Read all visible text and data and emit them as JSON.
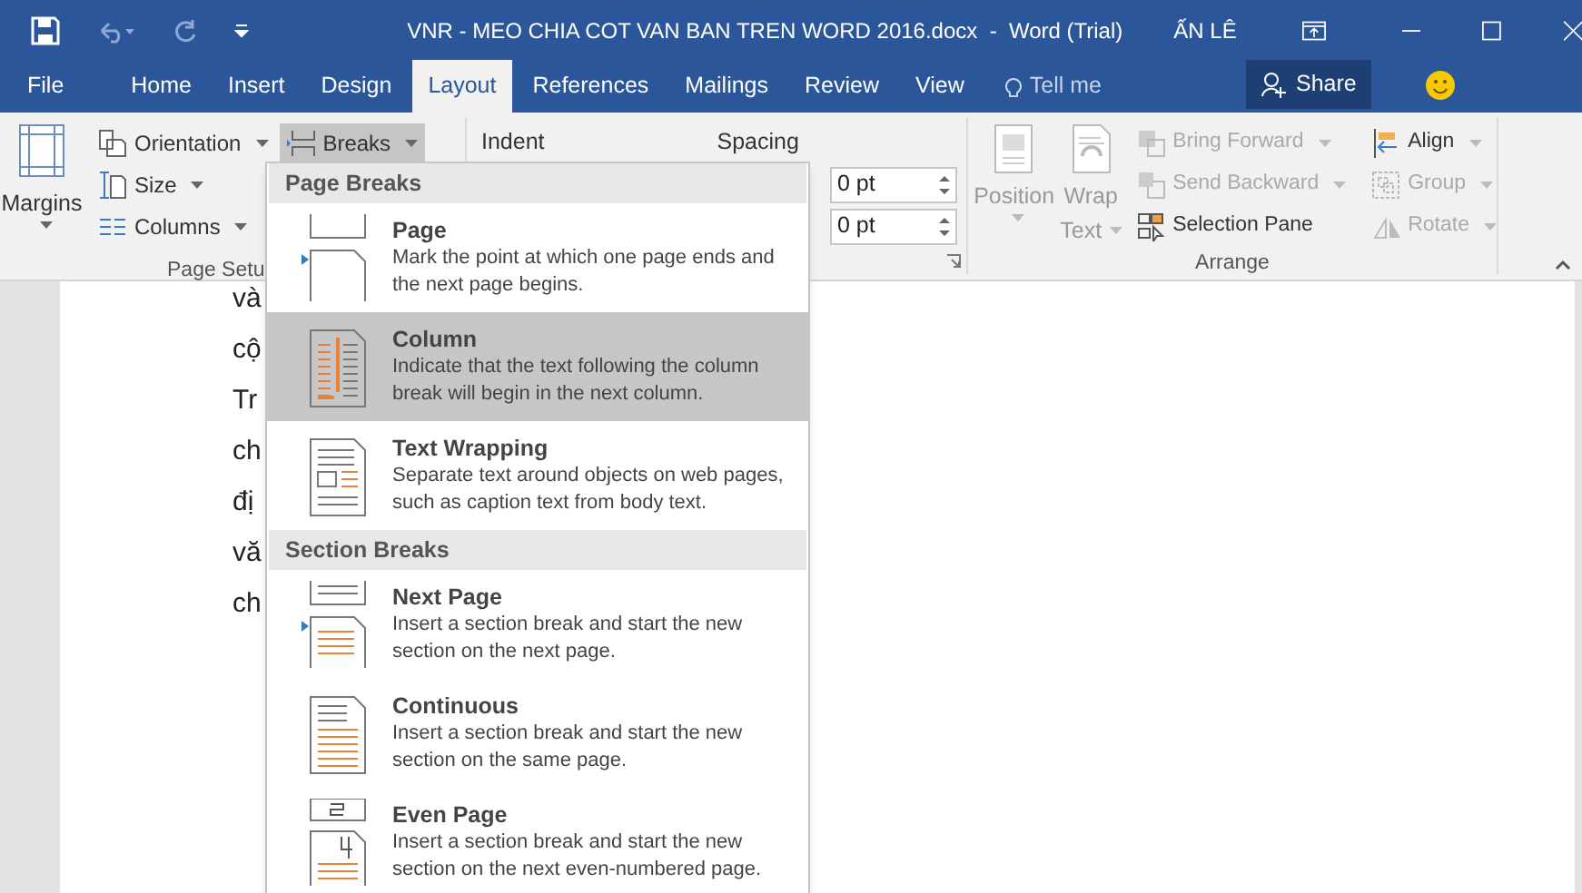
{
  "title_bar": {
    "title": "VNR - MEO CHIA COT VAN BAN TREN WORD 2016.docx  -  Word (Trial)",
    "user": "ẤN LÊ"
  },
  "tabs": [
    {
      "label": "File",
      "selected": false
    },
    {
      "label": "Home",
      "selected": false
    },
    {
      "label": "Insert",
      "selected": false
    },
    {
      "label": "Design",
      "selected": false
    },
    {
      "label": "Layout",
      "selected": true
    },
    {
      "label": "References",
      "selected": false
    },
    {
      "label": "Mailings",
      "selected": false
    },
    {
      "label": "Review",
      "selected": false
    },
    {
      "label": "View",
      "selected": false
    }
  ],
  "tell_me": {
    "placeholder": "Tell me"
  },
  "share_button": "Share",
  "page_setup": {
    "margins": "Margins",
    "orientation": "Orientation",
    "size": "Size",
    "columns": "Columns",
    "breaks": {
      "label": "Breaks",
      "expanded": true
    },
    "group_label": "Page Setu"
  },
  "paragraph": {
    "indent": "Indent",
    "spacing": "Spacing",
    "spacing_before": "0 pt",
    "spacing_after": "0 pt"
  },
  "arrange": {
    "position": "Position",
    "wrap": "Wrap",
    "text": "Text",
    "commands": [
      {
        "kind": "bring",
        "label": "Bring Forward",
        "disabled": true
      },
      {
        "kind": "send",
        "label": "Send Backward",
        "disabled": true
      },
      {
        "kind": "pane",
        "label": "Selection Pane",
        "disabled": false
      }
    ],
    "commands_right": [
      {
        "kind": "align",
        "label": "Align",
        "disabled": false
      },
      {
        "kind": "group",
        "label": "Group",
        "disabled": true
      },
      {
        "kind": "rotate",
        "label": "Rotate",
        "disabled": true
      }
    ],
    "group_label": "Arrange"
  },
  "document": {
    "lines": [
      "và",
      "cộ",
      "Tr",
      "ch",
      "đị",
      "vă",
      "ch"
    ]
  },
  "breaks_menu": [
    {
      "heading": "Page Breaks",
      "items": [
        {
          "kind": "page",
          "title": "Page",
          "description": "Mark the point at which one page ends and the next page begins.",
          "selected": false
        },
        {
          "kind": "column",
          "title": "Column",
          "description": "Indicate that the text following the column break will begin in the next column.",
          "selected": true
        },
        {
          "kind": "wrapping",
          "title": "Text Wrapping",
          "description": "Separate text around objects on web pages, such as caption text from body text.",
          "selected": false
        }
      ]
    },
    {
      "heading": "Section Breaks",
      "items": [
        {
          "kind": "next",
          "title": "Next Page",
          "description": "Insert a section break and start the new section on the next page.",
          "selected": false
        },
        {
          "kind": "continuous",
          "title": "Continuous",
          "description": "Insert a section break and start the new section on the same page.",
          "selected": false
        },
        {
          "kind": "even",
          "title": "Even Page",
          "description": "Insert a section break and start the new section on the next even-numbered page.",
          "selected": false
        }
      ]
    }
  ]
}
